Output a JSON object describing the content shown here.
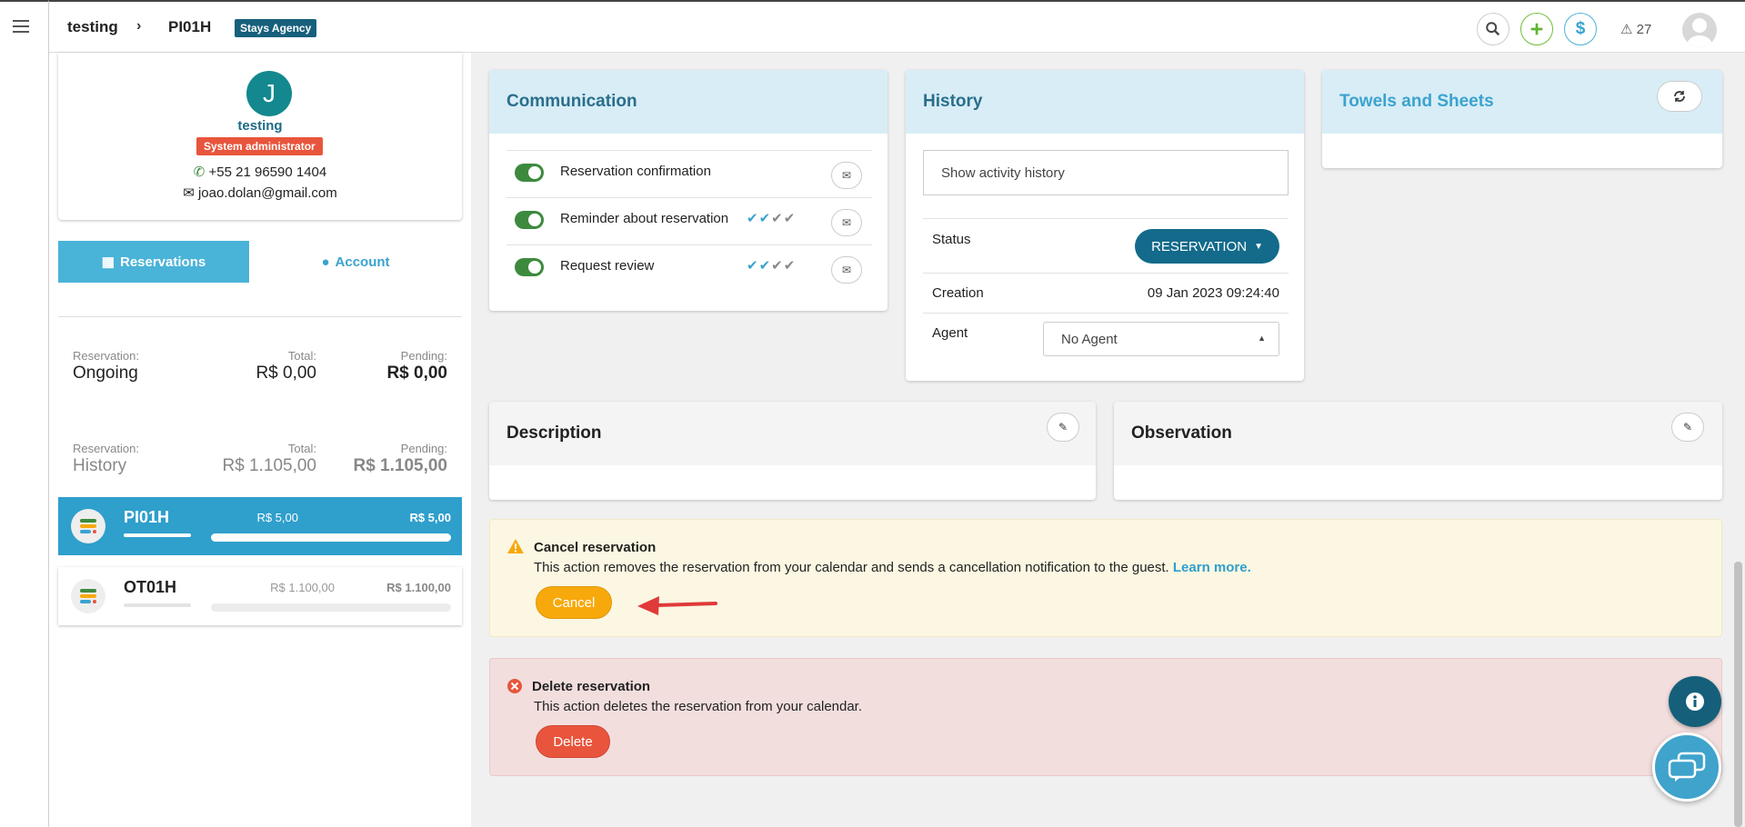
{
  "topbar": {
    "breadcrumb": [
      "testing",
      "PI01H"
    ],
    "agency_badge": "Stays Agency",
    "alert_count": "27"
  },
  "profile": {
    "initial": "J",
    "name": "testing",
    "role": "System administrator",
    "phone": "+55 21 96590 1404",
    "email": "joao.dolan@gmail.com"
  },
  "tabs": {
    "reservations": "Reservations",
    "account": "Account"
  },
  "summary": [
    {
      "label": "Reservation:",
      "value": "Ongoing",
      "total_label": "Total:",
      "total": "R$ 0,00",
      "pending_label": "Pending:",
      "pending": "R$ 0,00"
    },
    {
      "label": "Reservation:",
      "value": "History",
      "total_label": "Total:",
      "total": "R$ 1.105,00",
      "pending_label": "Pending:",
      "pending": "R$ 1.105,00"
    }
  ],
  "reservations": [
    {
      "code": "PI01H",
      "total": "R$ 5,00",
      "pending": "R$ 5,00",
      "progress": 1.0
    },
    {
      "code": "OT01H",
      "total": "R$ 1.100,00",
      "pending": "R$ 1.100,00",
      "progress": 0.0
    }
  ],
  "communication": {
    "title": "Communication",
    "items": [
      {
        "label": "Reservation confirmation",
        "checks": ""
      },
      {
        "label": "Reminder about reservation",
        "checks": "✔✔✔✔"
      },
      {
        "label": "Request review",
        "checks": "✔✔✔✔"
      }
    ]
  },
  "history": {
    "title": "History",
    "show_button": "Show activity history",
    "status_label": "Status",
    "status_value": "RESERVATION",
    "creation_label": "Creation",
    "creation_value": "09 Jan 2023 09:24:40",
    "agent_label": "Agent",
    "agent_value": "No Agent"
  },
  "towels": {
    "title": "Towels and Sheets"
  },
  "description": {
    "title": "Description"
  },
  "observation": {
    "title": "Observation"
  },
  "cancel_box": {
    "title": "Cancel reservation",
    "text": "This action removes the reservation from your calendar and sends a cancellation notification to the guest.",
    "link": "Learn more.",
    "button": "Cancel"
  },
  "delete_box": {
    "title": "Delete reservation",
    "text": "This action deletes the reservation from your calendar.",
    "button": "Delete"
  },
  "colors": {
    "accent": "#2f9fcc",
    "brand_dark": "#136a8a",
    "warning": "#f7a90c",
    "danger": "#e8553c",
    "toggle_on": "#3d8a3f"
  }
}
